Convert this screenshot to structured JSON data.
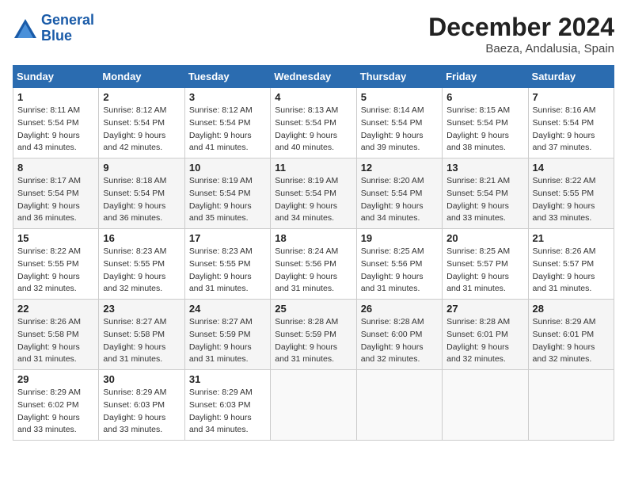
{
  "logo": {
    "text1": "General",
    "text2": "Blue"
  },
  "title": "December 2024",
  "subtitle": "Baeza, Andalusia, Spain",
  "days_of_week": [
    "Sunday",
    "Monday",
    "Tuesday",
    "Wednesday",
    "Thursday",
    "Friday",
    "Saturday"
  ],
  "weeks": [
    [
      {
        "day": "1",
        "sunrise": "8:11 AM",
        "sunset": "5:54 PM",
        "daylight": "9 hours and 43 minutes."
      },
      {
        "day": "2",
        "sunrise": "8:12 AM",
        "sunset": "5:54 PM",
        "daylight": "9 hours and 42 minutes."
      },
      {
        "day": "3",
        "sunrise": "8:12 AM",
        "sunset": "5:54 PM",
        "daylight": "9 hours and 41 minutes."
      },
      {
        "day": "4",
        "sunrise": "8:13 AM",
        "sunset": "5:54 PM",
        "daylight": "9 hours and 40 minutes."
      },
      {
        "day": "5",
        "sunrise": "8:14 AM",
        "sunset": "5:54 PM",
        "daylight": "9 hours and 39 minutes."
      },
      {
        "day": "6",
        "sunrise": "8:15 AM",
        "sunset": "5:54 PM",
        "daylight": "9 hours and 38 minutes."
      },
      {
        "day": "7",
        "sunrise": "8:16 AM",
        "sunset": "5:54 PM",
        "daylight": "9 hours and 37 minutes."
      }
    ],
    [
      {
        "day": "8",
        "sunrise": "8:17 AM",
        "sunset": "5:54 PM",
        "daylight": "9 hours and 36 minutes."
      },
      {
        "day": "9",
        "sunrise": "8:18 AM",
        "sunset": "5:54 PM",
        "daylight": "9 hours and 36 minutes."
      },
      {
        "day": "10",
        "sunrise": "8:19 AM",
        "sunset": "5:54 PM",
        "daylight": "9 hours and 35 minutes."
      },
      {
        "day": "11",
        "sunrise": "8:19 AM",
        "sunset": "5:54 PM",
        "daylight": "9 hours and 34 minutes."
      },
      {
        "day": "12",
        "sunrise": "8:20 AM",
        "sunset": "5:54 PM",
        "daylight": "9 hours and 34 minutes."
      },
      {
        "day": "13",
        "sunrise": "8:21 AM",
        "sunset": "5:54 PM",
        "daylight": "9 hours and 33 minutes."
      },
      {
        "day": "14",
        "sunrise": "8:22 AM",
        "sunset": "5:55 PM",
        "daylight": "9 hours and 33 minutes."
      }
    ],
    [
      {
        "day": "15",
        "sunrise": "8:22 AM",
        "sunset": "5:55 PM",
        "daylight": "9 hours and 32 minutes."
      },
      {
        "day": "16",
        "sunrise": "8:23 AM",
        "sunset": "5:55 PM",
        "daylight": "9 hours and 32 minutes."
      },
      {
        "day": "17",
        "sunrise": "8:23 AM",
        "sunset": "5:55 PM",
        "daylight": "9 hours and 31 minutes."
      },
      {
        "day": "18",
        "sunrise": "8:24 AM",
        "sunset": "5:56 PM",
        "daylight": "9 hours and 31 minutes."
      },
      {
        "day": "19",
        "sunrise": "8:25 AM",
        "sunset": "5:56 PM",
        "daylight": "9 hours and 31 minutes."
      },
      {
        "day": "20",
        "sunrise": "8:25 AM",
        "sunset": "5:57 PM",
        "daylight": "9 hours and 31 minutes."
      },
      {
        "day": "21",
        "sunrise": "8:26 AM",
        "sunset": "5:57 PM",
        "daylight": "9 hours and 31 minutes."
      }
    ],
    [
      {
        "day": "22",
        "sunrise": "8:26 AM",
        "sunset": "5:58 PM",
        "daylight": "9 hours and 31 minutes."
      },
      {
        "day": "23",
        "sunrise": "8:27 AM",
        "sunset": "5:58 PM",
        "daylight": "9 hours and 31 minutes."
      },
      {
        "day": "24",
        "sunrise": "8:27 AM",
        "sunset": "5:59 PM",
        "daylight": "9 hours and 31 minutes."
      },
      {
        "day": "25",
        "sunrise": "8:28 AM",
        "sunset": "5:59 PM",
        "daylight": "9 hours and 31 minutes."
      },
      {
        "day": "26",
        "sunrise": "8:28 AM",
        "sunset": "6:00 PM",
        "daylight": "9 hours and 32 minutes."
      },
      {
        "day": "27",
        "sunrise": "8:28 AM",
        "sunset": "6:01 PM",
        "daylight": "9 hours and 32 minutes."
      },
      {
        "day": "28",
        "sunrise": "8:29 AM",
        "sunset": "6:01 PM",
        "daylight": "9 hours and 32 minutes."
      }
    ],
    [
      {
        "day": "29",
        "sunrise": "8:29 AM",
        "sunset": "6:02 PM",
        "daylight": "9 hours and 33 minutes."
      },
      {
        "day": "30",
        "sunrise": "8:29 AM",
        "sunset": "6:03 PM",
        "daylight": "9 hours and 33 minutes."
      },
      {
        "day": "31",
        "sunrise": "8:29 AM",
        "sunset": "6:03 PM",
        "daylight": "9 hours and 34 minutes."
      },
      null,
      null,
      null,
      null
    ]
  ]
}
